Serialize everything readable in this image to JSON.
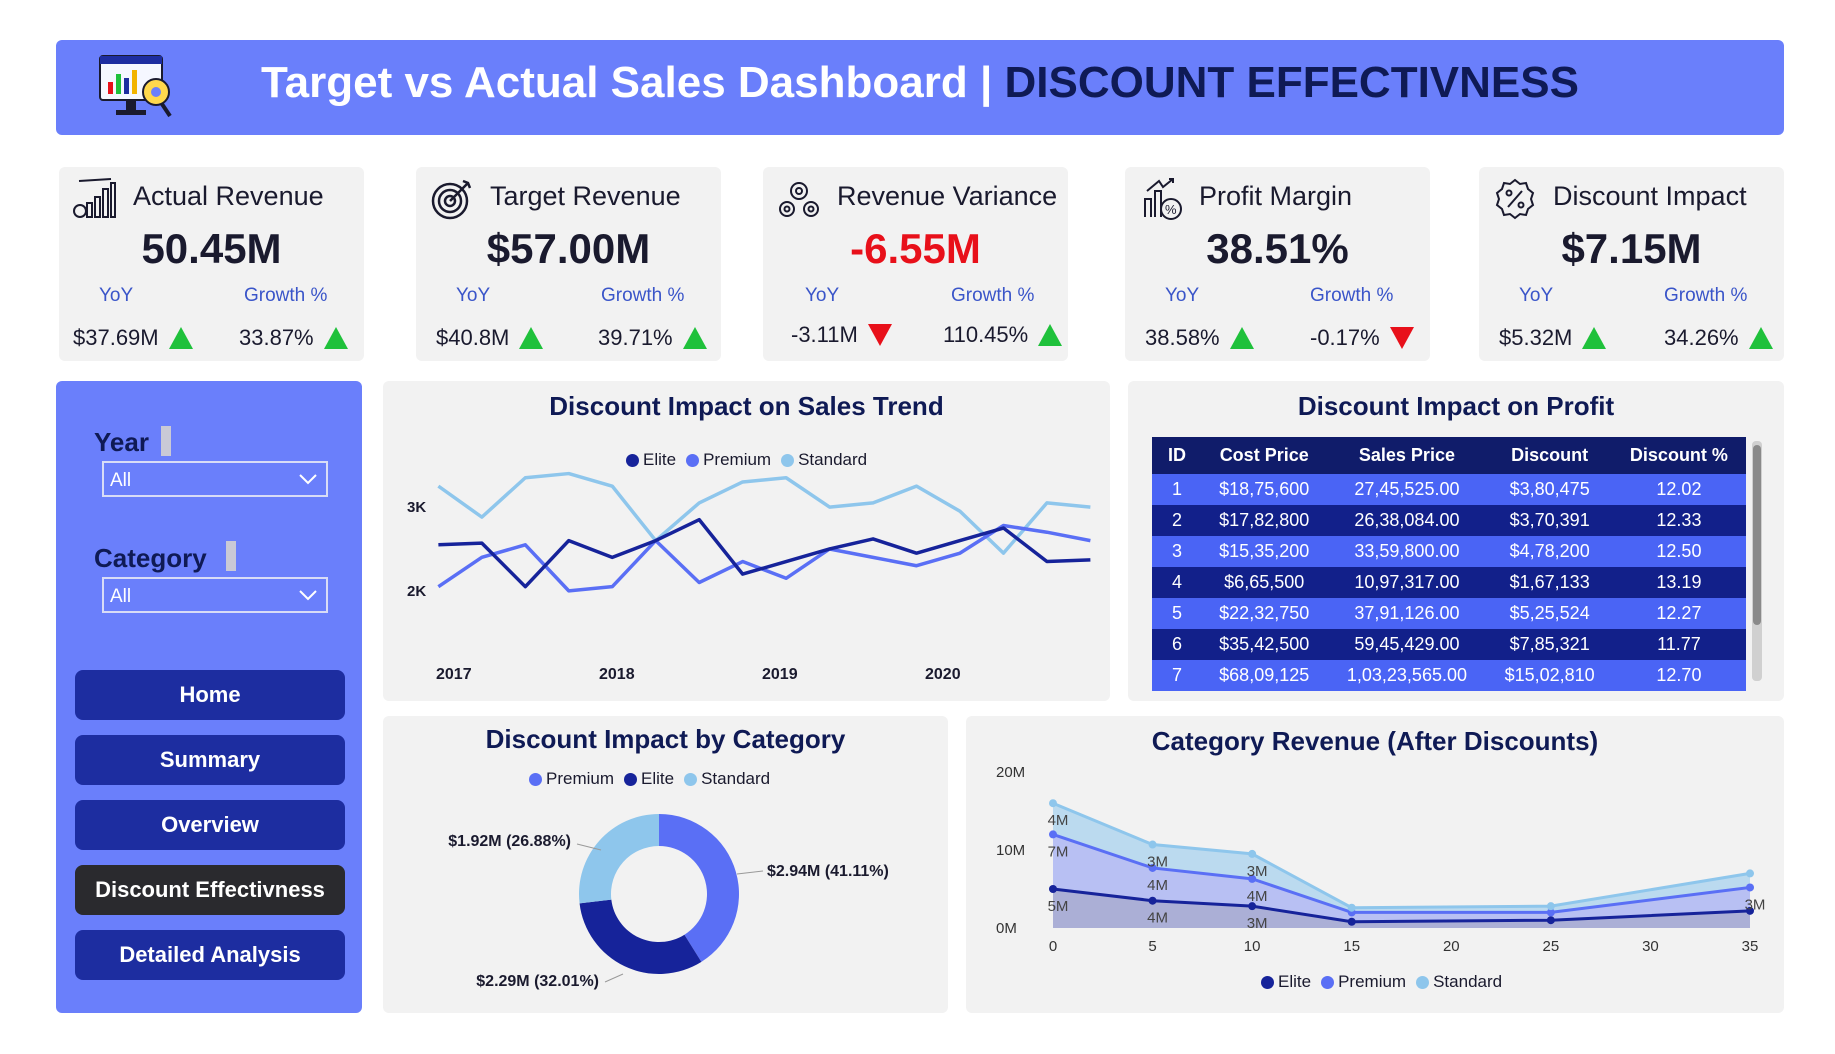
{
  "header": {
    "title_main": "Target vs Actual Sales Dashboard",
    "separator": "|",
    "title_sub": "DISCOUNT EFFECTIVNESS",
    "logo_icon": "dashboard-monitor-icon"
  },
  "kpis": [
    {
      "title": "Actual Revenue",
      "icon": "bar-chart-icon",
      "value": "50.45M",
      "negative": false,
      "yoy_label": "YoY",
      "growth_label": "Growth %",
      "yoy_value": "$37.69M",
      "yoy_trend": "up",
      "growth_value": "33.87%",
      "growth_trend": "up"
    },
    {
      "title": "Target Revenue",
      "icon": "target-icon",
      "value": "$57.00M",
      "negative": false,
      "yoy_label": "YoY",
      "growth_label": "Growth %",
      "yoy_value": "$40.8M",
      "yoy_trend": "up",
      "growth_value": "39.71%",
      "growth_trend": "up"
    },
    {
      "title": "Revenue Variance",
      "icon": "gears-icon",
      "value": "-6.55M",
      "negative": true,
      "yoy_label": "YoY",
      "growth_label": "Growth %",
      "yoy_value": "-3.11M",
      "yoy_trend": "down",
      "growth_value": "110.45%",
      "growth_trend": "up"
    },
    {
      "title": "Profit Margin",
      "icon": "percent-growth-icon",
      "value": "38.51%",
      "negative": false,
      "yoy_label": "YoY",
      "growth_label": "Growth %",
      "yoy_value": "38.58%",
      "yoy_trend": "up",
      "growth_value": "-0.17%",
      "growth_trend": "down"
    },
    {
      "title": "Discount Impact",
      "icon": "discount-badge-icon",
      "value": "$7.15M",
      "negative": false,
      "yoy_label": "YoY",
      "growth_label": "Growth %",
      "yoy_value": "$5.32M",
      "yoy_trend": "up",
      "growth_value": "34.26%",
      "growth_trend": "up"
    }
  ],
  "sidebar": {
    "year_label": "Year",
    "year_value": "All",
    "category_label": "Category",
    "category_value": "All",
    "nav": [
      "Home",
      "Summary",
      "Overview",
      "Discount Effectivness",
      "Detailed Analysis"
    ],
    "active_nav": "Discount Effectivness"
  },
  "colors": {
    "elite": "#16239a",
    "premium": "#5a6ff5",
    "standard": "#8ec6ec",
    "accent": "#6a7ffb",
    "positive": "#1fc13b",
    "negative": "#e8101a"
  },
  "chart_data": [
    {
      "type": "line",
      "title": "Discount Impact on Sales Trend",
      "x_tick_labels": [
        "2017",
        "2018",
        "2019",
        "2020"
      ],
      "y_tick_labels": [
        "2K",
        "3K"
      ],
      "ylim": [
        1700,
        3550
      ],
      "legend": "top-center",
      "series": [
        {
          "name": "Elite",
          "values": [
            2550,
            2570,
            2050,
            2600,
            2400,
            2600,
            2850,
            2200,
            2350,
            2500,
            2620,
            2450,
            2600,
            2750,
            2350,
            2370
          ]
        },
        {
          "name": "Premium",
          "values": [
            2050,
            2400,
            2550,
            2000,
            2050,
            2600,
            2100,
            2350,
            2150,
            2500,
            2400,
            2300,
            2450,
            2780,
            2700,
            2600
          ]
        },
        {
          "name": "Standard",
          "values": [
            3250,
            2880,
            3350,
            3400,
            3250,
            2600,
            3050,
            3300,
            3350,
            3000,
            3050,
            3250,
            2950,
            2450,
            3050,
            3000
          ]
        }
      ]
    },
    {
      "type": "table",
      "title": "Discount Impact on Profit",
      "columns": [
        "ID",
        "Cost Price",
        "Sales Price",
        "Discount",
        "Discount %"
      ],
      "rows": [
        [
          "1",
          "$18,75,600",
          "27,45,525.00",
          "$3,80,475",
          "12.02"
        ],
        [
          "2",
          "$17,82,800",
          "26,38,084.00",
          "$3,70,391",
          "12.33"
        ],
        [
          "3",
          "$15,35,200",
          "33,59,800.00",
          "$4,78,200",
          "12.50"
        ],
        [
          "4",
          "$6,65,500",
          "10,97,317.00",
          "$1,67,133",
          "13.19"
        ],
        [
          "5",
          "$22,32,750",
          "37,91,126.00",
          "$5,25,524",
          "12.27"
        ],
        [
          "6",
          "$35,42,500",
          "59,45,429.00",
          "$7,85,321",
          "11.77"
        ],
        [
          "7",
          "$68,09,125",
          "1,03,23,565.00",
          "$15,02,810",
          "12.70"
        ]
      ]
    },
    {
      "type": "pie",
      "title": "Discount Impact by Category",
      "legend": "top-center",
      "slices": [
        {
          "name": "Premium",
          "value": 41.11,
          "label": "$2.94M (41.11%)"
        },
        {
          "name": "Elite",
          "value": 32.01,
          "label": "$2.29M (32.01%)"
        },
        {
          "name": "Standard",
          "value": 26.88,
          "label": "$1.92M (26.88%)"
        }
      ]
    },
    {
      "type": "area",
      "title": "Category Revenue (After Discounts)",
      "x": [
        0,
        5,
        10,
        15,
        25,
        35
      ],
      "x_ticks": [
        "0",
        "5",
        "10",
        "15",
        "20",
        "25",
        "30",
        "35"
      ],
      "xlim": [
        0,
        35
      ],
      "y_ticks": [
        "0M",
        "10M",
        "20M"
      ],
      "ylim": [
        0,
        20
      ],
      "stacked": true,
      "legend": "bottom-center",
      "series": [
        {
          "name": "Elite",
          "values": [
            5.0,
            3.5,
            2.8,
            0.8,
            1.0,
            2.2
          ]
        },
        {
          "name": "Premium",
          "values": [
            7.0,
            4.2,
            3.5,
            1.2,
            1.0,
            3.0
          ]
        },
        {
          "name": "Standard",
          "values": [
            4.0,
            3.0,
            3.2,
            0.6,
            0.8,
            1.8
          ]
        }
      ],
      "data_labels": [
        {
          "series": "Standard",
          "index": 0,
          "text": "4M"
        },
        {
          "series": "Premium",
          "index": 0,
          "text": "7M"
        },
        {
          "series": "Elite",
          "index": 0,
          "text": "5M"
        },
        {
          "series": "Standard",
          "index": 1,
          "text": "3M"
        },
        {
          "series": "Premium",
          "index": 1,
          "text": "4M"
        },
        {
          "series": "Elite",
          "index": 1,
          "text": "4M"
        },
        {
          "series": "Standard",
          "index": 2,
          "text": "3M"
        },
        {
          "series": "Premium",
          "index": 2,
          "text": "4M"
        },
        {
          "series": "Elite",
          "index": 2,
          "text": "3M"
        },
        {
          "series": "Premium",
          "index": 5,
          "text": "3M"
        }
      ]
    }
  ]
}
